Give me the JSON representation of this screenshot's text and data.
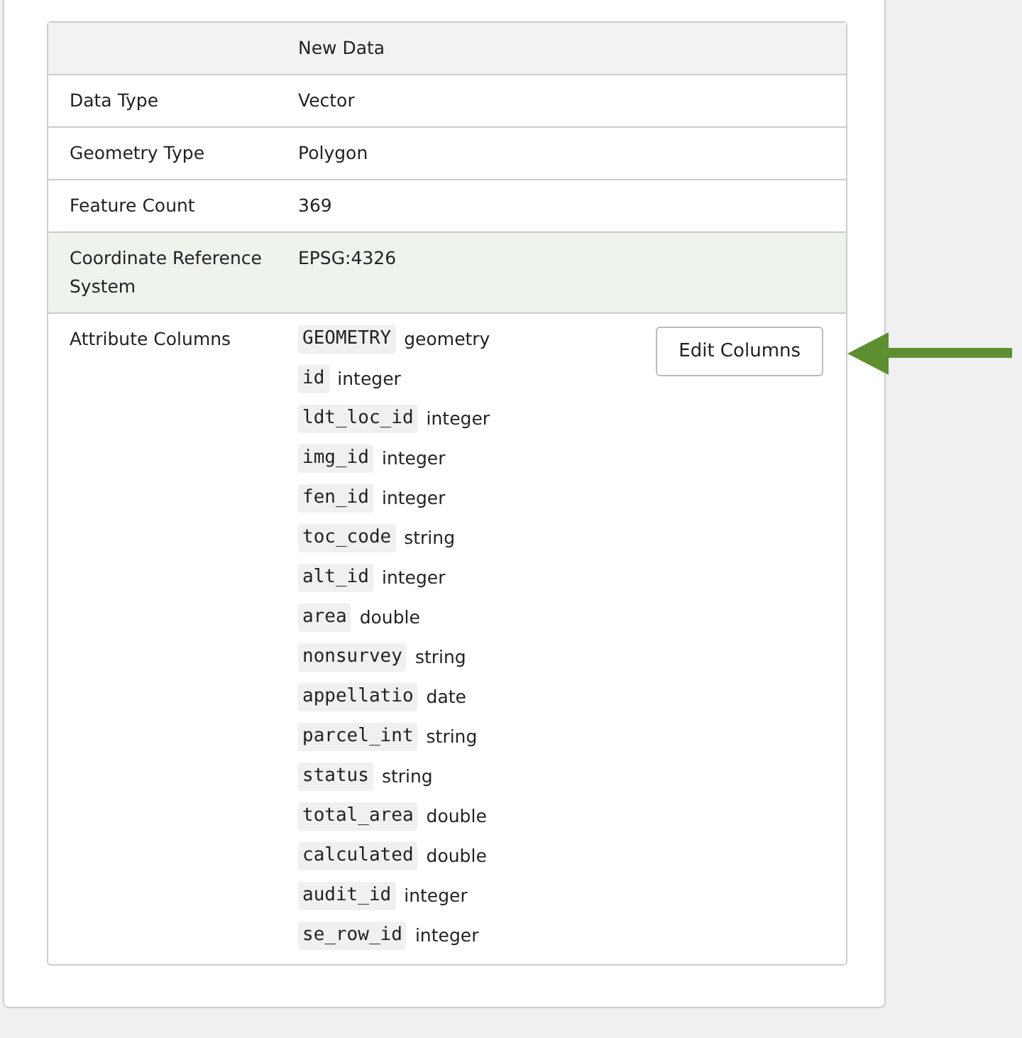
{
  "table": {
    "header": "New Data",
    "rows": [
      {
        "label": "Data Type",
        "value": "Vector",
        "highlighted": false
      },
      {
        "label": "Geometry Type",
        "value": "Polygon",
        "highlighted": false
      },
      {
        "label": "Feature Count",
        "value": "369",
        "highlighted": false
      },
      {
        "label": "Coordinate Reference System",
        "value": "EPSG:4326",
        "highlighted": true
      }
    ],
    "attributes": {
      "label": "Attribute Columns",
      "button": "Edit Columns",
      "columns": [
        {
          "name": "GEOMETRY",
          "type": "geometry"
        },
        {
          "name": "id",
          "type": "integer"
        },
        {
          "name": "ldt_loc_id",
          "type": "integer"
        },
        {
          "name": "img_id",
          "type": "integer"
        },
        {
          "name": "fen_id",
          "type": "integer"
        },
        {
          "name": "toc_code",
          "type": "string"
        },
        {
          "name": "alt_id",
          "type": "integer"
        },
        {
          "name": "area",
          "type": "double"
        },
        {
          "name": "nonsurvey",
          "type": "string"
        },
        {
          "name": "appellatio",
          "type": "date"
        },
        {
          "name": "parcel_int",
          "type": "string"
        },
        {
          "name": "status",
          "type": "string"
        },
        {
          "name": "total_area",
          "type": "double"
        },
        {
          "name": "calculated",
          "type": "double"
        },
        {
          "name": "audit_id",
          "type": "integer"
        },
        {
          "name": "se_row_id",
          "type": "integer"
        }
      ]
    }
  }
}
